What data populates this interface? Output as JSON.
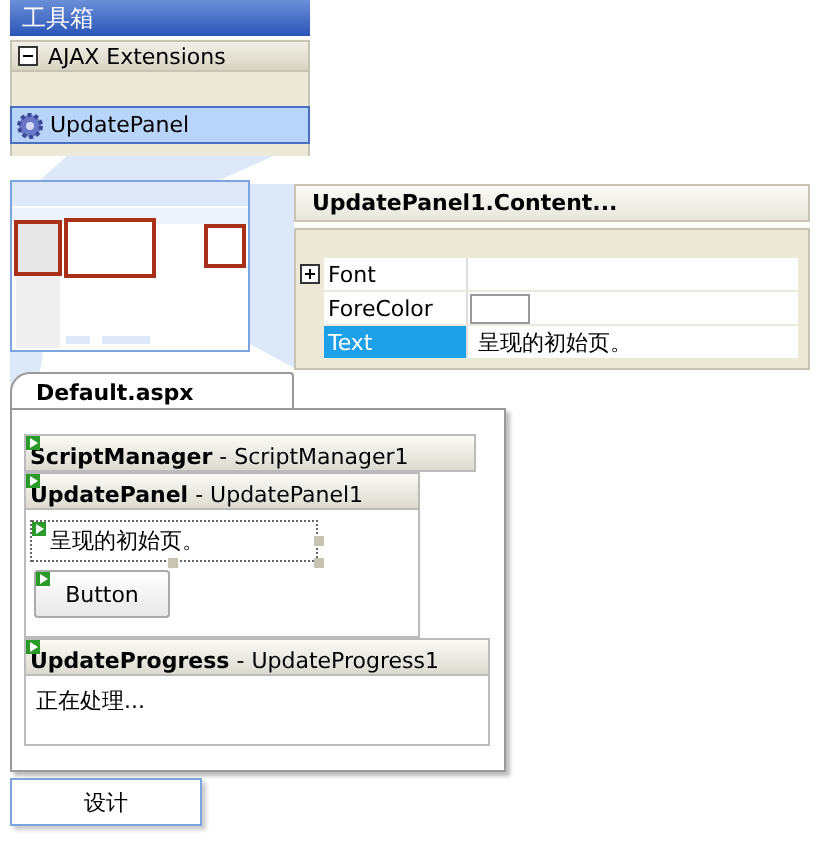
{
  "toolbox": {
    "title": "工具箱",
    "group": {
      "label": "AJAX Extensions",
      "expanded": true
    },
    "items": [
      {
        "label": "UpdatePanel",
        "selected": true
      }
    ]
  },
  "properties": {
    "title": "UpdatePanel1.Content...",
    "rows": [
      {
        "name": "Font",
        "kind": "group",
        "expanded": false,
        "selected": false
      },
      {
        "name": "ForeColor",
        "kind": "color",
        "selected": false
      },
      {
        "name": "Text",
        "kind": "text",
        "value": "呈现的初始页。",
        "selected": true
      }
    ]
  },
  "document": {
    "tab": "Default.aspx",
    "controls": [
      {
        "kind": "bar",
        "label": "**ScriptManager** - ScriptManager1"
      },
      {
        "kind": "panel",
        "label": "**UpdatePanel** - UpdatePanel1",
        "children": [
          {
            "kind": "label",
            "text": "呈现的初始页。"
          },
          {
            "kind": "button",
            "text": "Button"
          }
        ]
      },
      {
        "kind": "progress",
        "label": "**UpdateProgress** - UpdateProgress1",
        "children": [
          {
            "kind": "text",
            "text": "正在处理..."
          }
        ]
      }
    ]
  },
  "view_tabs": [
    {
      "label": "设计",
      "selected": true
    }
  ]
}
